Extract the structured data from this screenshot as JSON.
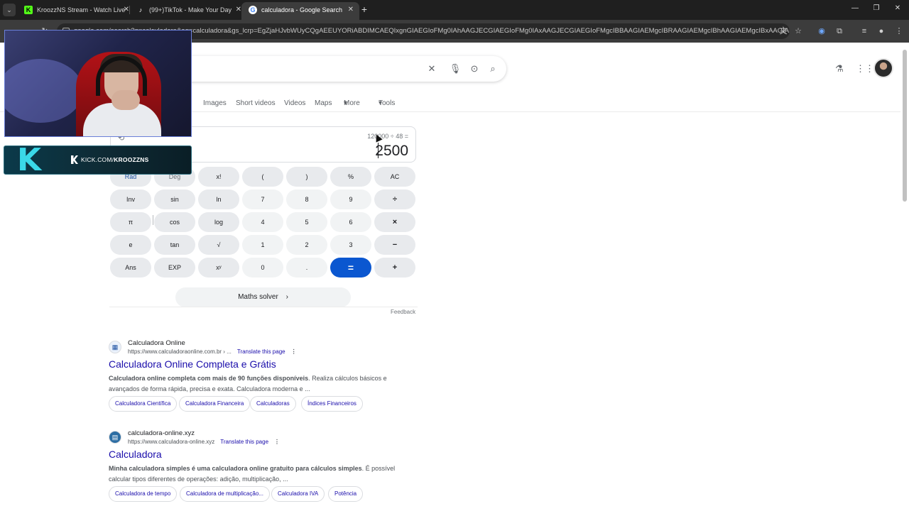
{
  "browser": {
    "tabs": [
      {
        "title": "KroozzNS Stream - Watch Live",
        "icon": "kick-icon",
        "color": "#53fc18"
      },
      {
        "title": "(99+)TikTok - Make Your Day",
        "icon": "tiktok-icon",
        "color": "#ffffff"
      },
      {
        "title": "calculadora - Google Search",
        "icon": "google-icon",
        "color": "#4285f4"
      }
    ],
    "url": "google.com/search?q=calculadora&oq=calculadora&gs_lcrp=EgZjaHJvbWUyCQgAEEUYORiABDIMCAEQIxgnGIAEGIoFMg0IAhAAGJECGIAEGIoFMg0IAxAAGJECGIAEGIoFMgcIBBAAGIAEMgcIBRAAGIAEMgcIBhAAGIAEMgcIBxAAGIAEMgcICB..."
  },
  "header": {
    "filters": [
      "Images",
      "Short videos",
      "Videos",
      "Maps",
      "More",
      "Tools"
    ]
  },
  "calculator": {
    "expression": "120000 ÷ 48 =",
    "result": "2500",
    "keys": [
      [
        "Rad",
        "Deg",
        "x!",
        "(",
        ")",
        "%",
        "AC"
      ],
      [
        "Inv",
        "sin",
        "ln",
        "7",
        "8",
        "9",
        "÷"
      ],
      [
        "π",
        "cos",
        "log",
        "4",
        "5",
        "6",
        "×"
      ],
      [
        "e",
        "tan",
        "√",
        "1",
        "2",
        "3",
        "−"
      ],
      [
        "Ans",
        "EXP",
        "xʸ",
        "0",
        ".",
        "=",
        "+"
      ]
    ],
    "solver_label": "Maths solver",
    "feedback_label": "Feedback",
    "accent_color": "#0b57d0"
  },
  "results": [
    {
      "site": "Calculadora Online",
      "url": "https://www.calculadoraonline.com.br › ...",
      "translate": "Translate this page",
      "title": "Calculadora Online Completa e Grátis",
      "snippet_bold": "Calculadora online completa com mais de 90 funções disponíveis",
      "snippet": ". Realiza cálculos básicos e avançados de forma rápida, precisa e exata. Calculadora moderna e ...",
      "chips": [
        "Calculadora Científica",
        "Calculadora Financeira",
        "Calculadoras",
        "Índices Financeiros"
      ]
    },
    {
      "site": "calculadora-online.xyz",
      "url": "https://www.calculadora-online.xyz",
      "translate": "Translate this page",
      "title": "Calculadora",
      "snippet_bold": "Minha calculadora simples é uma calculadora online gratuito para cálculos simples",
      "snippet": ". É possível calcular tipos diferentes de operações: adição, multiplicação, ...",
      "chips": [
        "Calculadora de tempo",
        "Calculadora de multiplicação...",
        "Calculadora IVA",
        "Potência"
      ]
    }
  ],
  "overlay": {
    "kick_prefix": "KICK.COM/",
    "kick_channel": "KROOZZNS",
    "brand_color": "#3ad8e8"
  }
}
